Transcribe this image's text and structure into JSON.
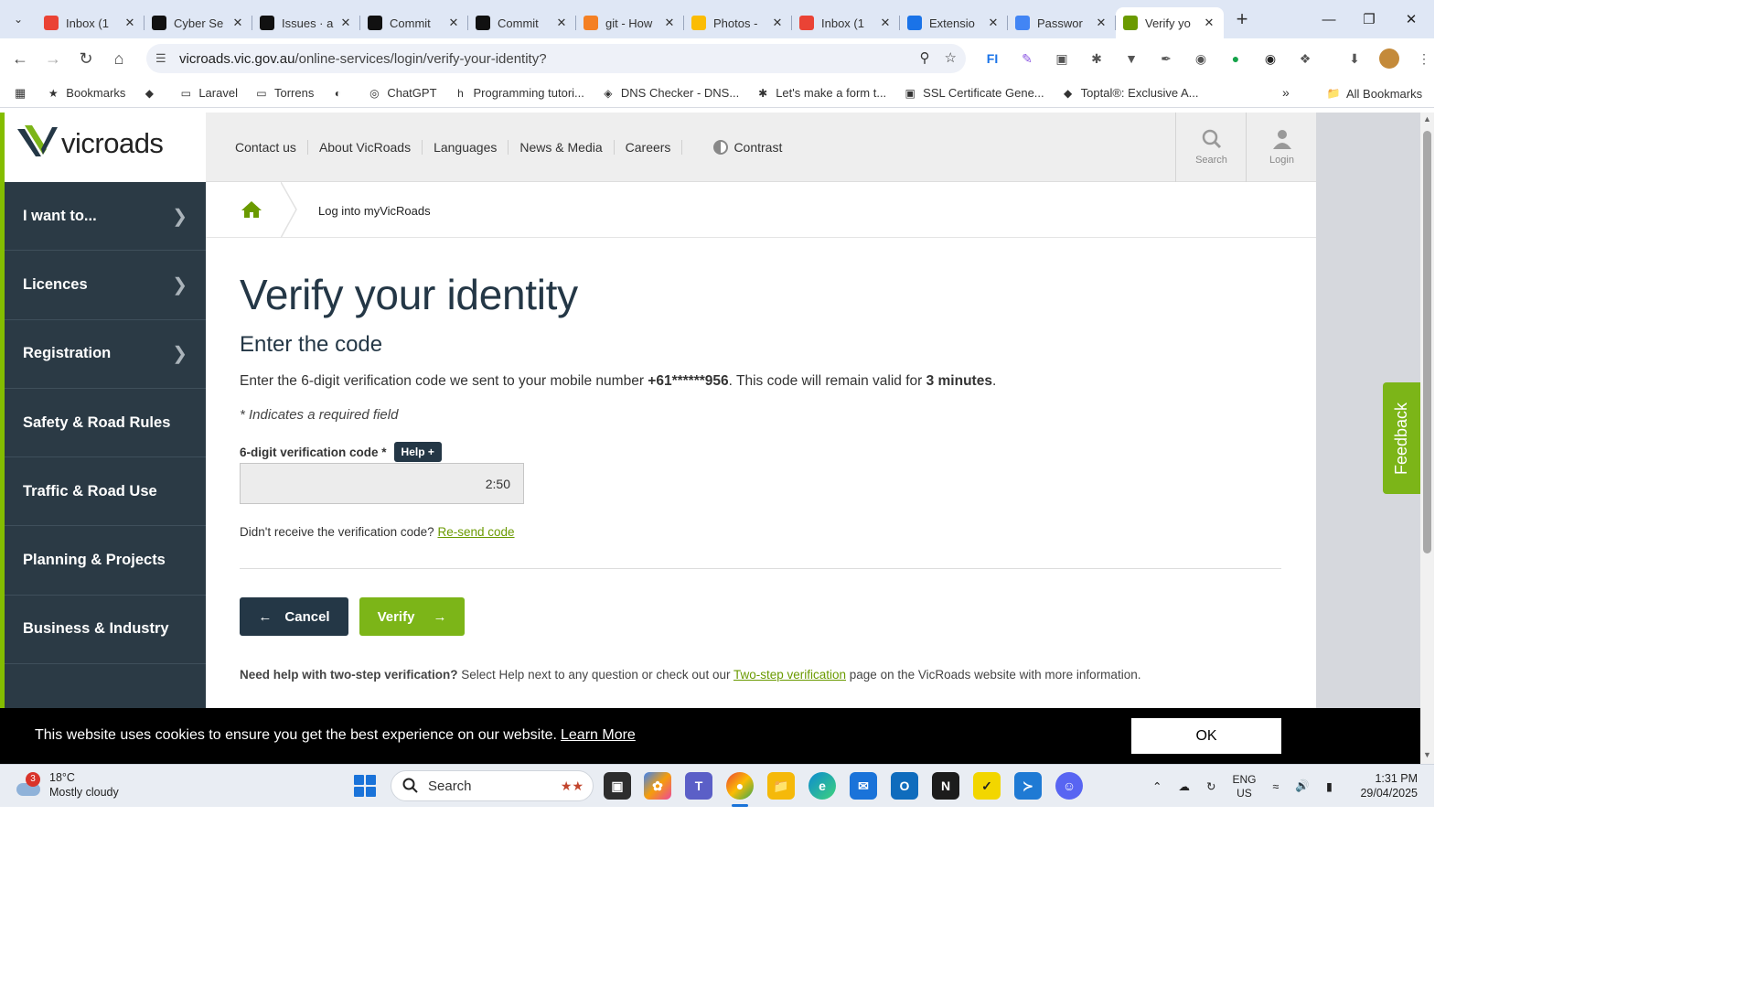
{
  "browser": {
    "tabs": [
      {
        "title": "Inbox (1",
        "favicon": "gmail-icon",
        "color": "#ea4335"
      },
      {
        "title": "Cyber Se",
        "favicon": "github-icon",
        "color": "#111111"
      },
      {
        "title": "Issues · a",
        "favicon": "github-icon",
        "color": "#111111"
      },
      {
        "title": "Commit",
        "favicon": "github-icon",
        "color": "#111111"
      },
      {
        "title": "Commit",
        "favicon": "openai-icon",
        "color": "#111111"
      },
      {
        "title": "git - How",
        "favicon": "stackoverflow-icon",
        "color": "#f48024"
      },
      {
        "title": "Photos - ",
        "favicon": "photos-icon",
        "color": "#fbbc04"
      },
      {
        "title": "Inbox (1",
        "favicon": "gmail-icon",
        "color": "#ea4335"
      },
      {
        "title": "Extensio",
        "favicon": "puzzle-icon",
        "color": "#1a73e8"
      },
      {
        "title": "Passwor",
        "favicon": "google-icon",
        "color": "#4285f4"
      },
      {
        "title": "Verify yo",
        "favicon": "vicroads-icon",
        "color": "#6a9a00",
        "active": true
      }
    ],
    "url_host": "vicroads.vic.gov.au",
    "url_path": "/online-services/login/verify-your-identity?",
    "bookmarks": [
      {
        "label": "Bookmarks",
        "icon": "star-icon"
      },
      {
        "label": "",
        "icon": "laravel-icon"
      },
      {
        "label": "Laravel",
        "icon": "folder-icon"
      },
      {
        "label": "Torrens",
        "icon": "folder-icon"
      },
      {
        "label": "",
        "icon": "globe-icon"
      },
      {
        "label": "ChatGPT",
        "icon": "openai-icon"
      },
      {
        "label": "Programming tutori...",
        "icon": "bookmark-icon"
      },
      {
        "label": "DNS Checker - DNS...",
        "icon": "shield-icon"
      },
      {
        "label": "Let's make a form t...",
        "icon": "asterisk-icon"
      },
      {
        "label": "SSL Certificate Gene...",
        "icon": "certificate-icon"
      },
      {
        "label": "Toptal®: Exclusive A...",
        "icon": "toptal-icon"
      }
    ],
    "all_bookmarks": "All Bookmarks"
  },
  "site": {
    "logo_text": "vicroads",
    "topnav": [
      "Contact us",
      "About VicRoads",
      "Languages",
      "News & Media",
      "Careers"
    ],
    "contrast": "Contrast",
    "search_label": "Search",
    "login_label": "Login",
    "sidenav": [
      {
        "label": "I want to...",
        "chevron": true
      },
      {
        "label": "Licences",
        "chevron": true
      },
      {
        "label": "Registration",
        "chevron": true
      },
      {
        "label": "Safety & Road Rules",
        "chevron": false
      },
      {
        "label": "Traffic & Road Use",
        "chevron": false
      },
      {
        "label": "Planning & Projects",
        "chevron": false
      },
      {
        "label": "Business & Industry",
        "chevron": false
      }
    ],
    "breadcrumb": "Log into myVicRoads",
    "heading": "Verify your identity",
    "subheading": "Enter the code",
    "intro_pre": "Enter the 6-digit verification code we sent to your mobile number ",
    "intro_phone": "+61******956",
    "intro_mid": ". This code will remain valid for ",
    "intro_time": "3 minutes",
    "intro_post": ".",
    "required_note": "* Indicates a required field",
    "field_label": "6-digit verification code *",
    "help_label": "Help +",
    "timer": "2:50",
    "resend_prefix": "Didn't receive the verification code?",
    "resend_link": "Re-send code",
    "cancel_label": "Cancel",
    "verify_label": "Verify",
    "help_bold": "Need help with two-step verification?",
    "help_text": " Select Help next to any question or check out our ",
    "help_link": "Two-step verification",
    "help_suffix": " page on the VicRoads website with more information.",
    "feedback": "Feedback",
    "cookie_text": "This website uses cookies to ensure you get the best experience on our website.",
    "cookie_link": "Learn More",
    "cookie_ok": "OK"
  },
  "taskbar": {
    "weather_badge": "3",
    "temperature": "18°C",
    "condition": "Mostly cloudy",
    "search_placeholder": "Search",
    "lang1": "ENG",
    "lang2": "US",
    "time": "1:31 PM",
    "date": "29/04/2025"
  },
  "colors": {
    "accent_green": "#7cb518",
    "navy": "#243746",
    "sidebar": "#2b3a45"
  }
}
